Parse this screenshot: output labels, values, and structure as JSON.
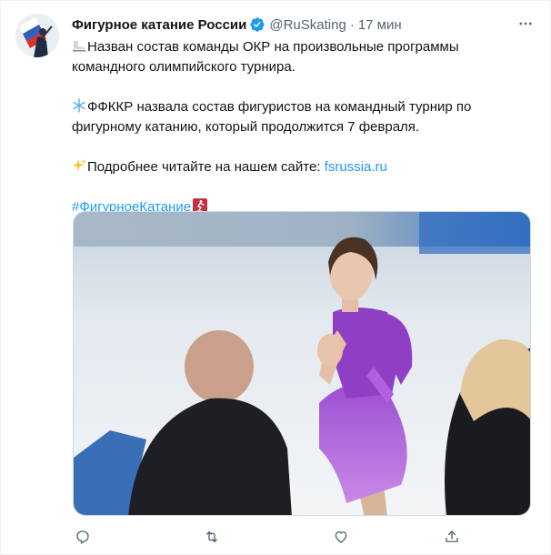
{
  "tweet": {
    "author_name": "Фигурное катание России",
    "author_handle": "@RuSkating",
    "separator": "·",
    "time": "17 мин",
    "lines": {
      "l1": "Назван состав команды ОКР на произвольные программы",
      "l2": "командного олимпийского турнира.",
      "l3": "ФФККР назвала состав фигуристов на командный турнир по",
      "l4": "фигурному катанию, который продолжится 7 февраля.",
      "l5_text": "Подробнее читайте на нашем сайте: ",
      "l5_link": "fsrussia.ru",
      "hashtag": "#ФигурноеКатание"
    },
    "icons": {
      "verified": "verified-badge-icon",
      "more": "more-icon",
      "emoji1": "skate-emoji-icon",
      "emoji2": "snowflake-emoji-icon",
      "emoji3": "sparkles-emoji-icon",
      "emoji4": "figure-skating-emoji-icon",
      "reply": "reply-icon",
      "retweet": "retweet-icon",
      "like": "like-icon",
      "share": "share-icon"
    },
    "colors": {
      "link": "#1d9bf0",
      "verified": "#1d9bf0",
      "muted": "#536471"
    }
  }
}
